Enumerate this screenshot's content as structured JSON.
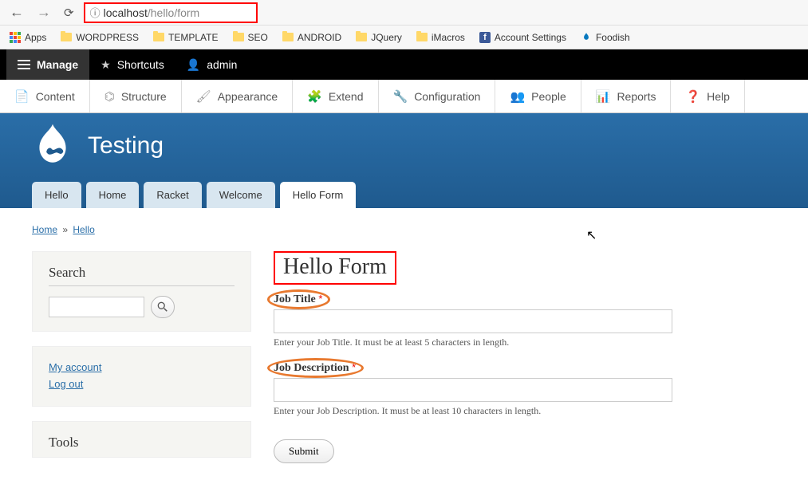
{
  "browser": {
    "url_host": "localhost",
    "url_path": "/hello/form"
  },
  "bookmarks": {
    "apps": "Apps",
    "items": [
      "WORDPRESS",
      "TEMPLATE",
      "SEO",
      "ANDROID",
      "JQuery",
      "iMacros"
    ],
    "account": "Account Settings",
    "foodish": "Foodish"
  },
  "toolbar": {
    "manage": "Manage",
    "shortcuts": "Shortcuts",
    "admin": "admin"
  },
  "admin_menu": [
    "Content",
    "Structure",
    "Appearance",
    "Extend",
    "Configuration",
    "People",
    "Reports",
    "Help"
  ],
  "site_name": "Testing",
  "tabs": [
    "Hello",
    "Home",
    "Racket",
    "Welcome",
    "Hello Form"
  ],
  "active_tab": 4,
  "breadcrumb": {
    "home": "Home",
    "hello": "Hello"
  },
  "sidebar": {
    "search_title": "Search",
    "my_account": "My account",
    "log_out": "Log out",
    "tools_title": "Tools"
  },
  "page": {
    "title": "Hello Form",
    "field1_label": "Job Title",
    "field1_desc": "Enter your Job Title. It must be at least 5 characters in length.",
    "field2_label": "Job Description",
    "field2_desc": "Enter your Job Description. It must be at least 10 characters in length.",
    "submit": "Submit"
  }
}
